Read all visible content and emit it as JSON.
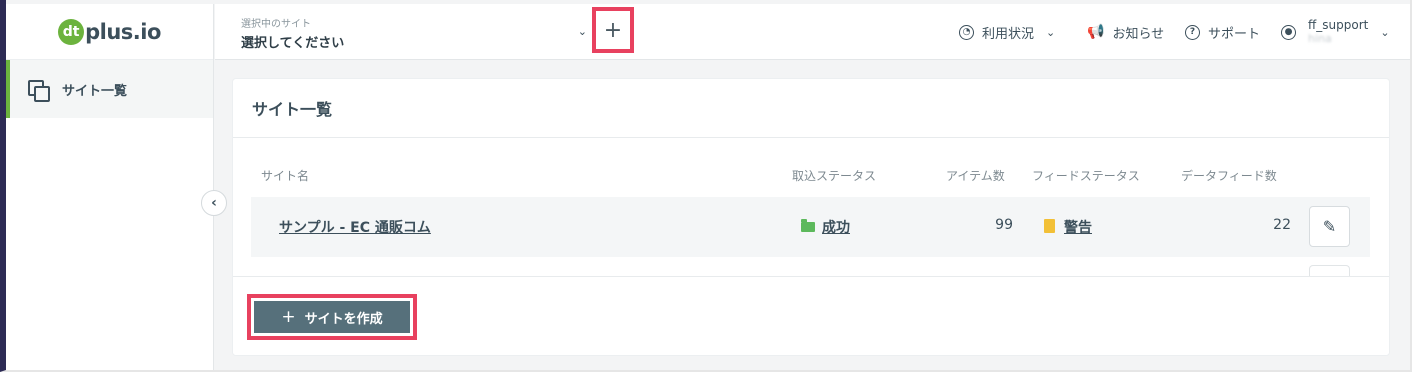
{
  "brand": {
    "logo_mark": "dt",
    "logo_text": "plus.io",
    "accent": "#6cb33e"
  },
  "sidebar": {
    "items": [
      {
        "label": "サイト一覧",
        "icon": "copy-icon"
      }
    ],
    "collapse_icon": "chevron-left-icon"
  },
  "header": {
    "site_select": {
      "caption": "選択中のサイト",
      "value": "選択してください"
    },
    "add_site_icon": "plus-icon",
    "nav": [
      {
        "label": "利用状況",
        "icon": "gauge-icon"
      },
      {
        "label": "お知らせ",
        "icon": "megaphone-icon"
      },
      {
        "label": "サポート",
        "icon": "help-icon"
      }
    ],
    "user": {
      "name": "ff_support",
      "sub": "hina"
    }
  },
  "main": {
    "title": "サイト一覧",
    "columns": [
      "サイト名",
      "取込ステータス",
      "アイテム数",
      "フィードステータス",
      "データフィード数"
    ],
    "rows": [
      {
        "name": "サンプル - EC 通販コム",
        "import_status": "成功",
        "items": "99",
        "feed_status": "警告",
        "feed_count": "22"
      }
    ],
    "create_label": "サイトを作成"
  },
  "colors": {
    "highlight": "#e8415f",
    "button": "#56707b",
    "success": "#5cb95c",
    "warning": "#f2c037"
  }
}
